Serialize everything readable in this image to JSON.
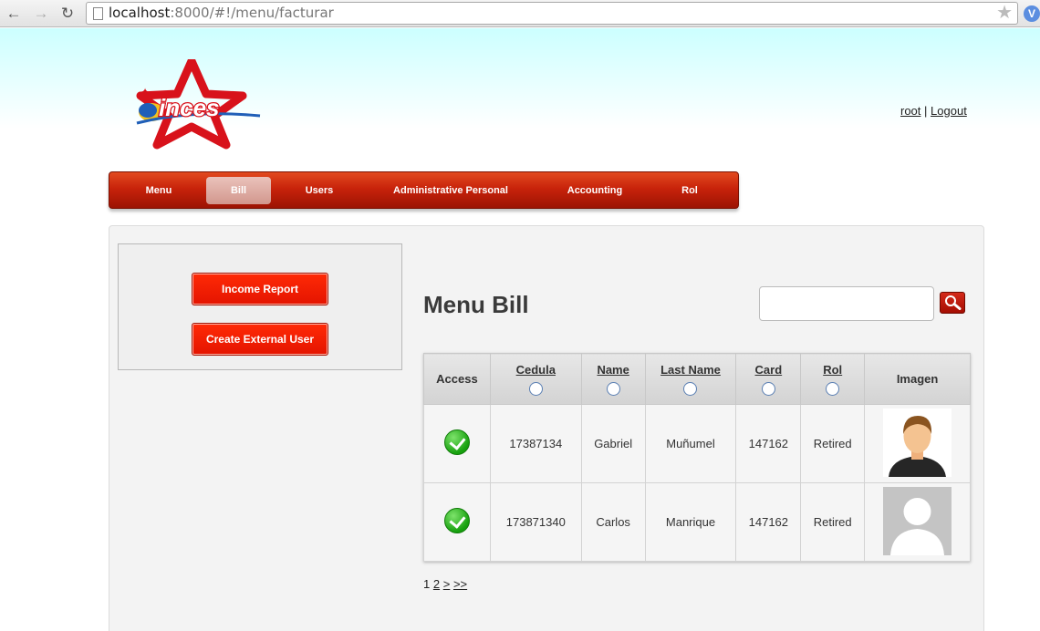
{
  "browser": {
    "url_host": "localhost",
    "url_rest": ":8000/#!/menu/facturar"
  },
  "header": {
    "user": "root",
    "separator": "|",
    "logout": "Logout"
  },
  "nav": {
    "items": [
      {
        "label": "Menu"
      },
      {
        "label": "Bill"
      },
      {
        "label": "Users"
      },
      {
        "label": "Administrative Personal"
      },
      {
        "label": "Accounting"
      },
      {
        "label": "Rol"
      }
    ],
    "active": "Bill"
  },
  "sidebar": {
    "income_report": "Income Report",
    "create_external_user": "Create External User"
  },
  "main": {
    "title": "Menu Bill",
    "search_value": ""
  },
  "table": {
    "headers": {
      "access": "Access",
      "cedula": "Cedula",
      "name": "Name",
      "last_name": "Last Name",
      "card": "Card",
      "rol": "Rol",
      "imagen": "Imagen"
    },
    "rows": [
      {
        "cedula": "17387134",
        "name": "Gabriel",
        "last_name": "Muñumel",
        "card": "147162",
        "rol": "Retired"
      },
      {
        "cedula": "173871340",
        "name": "Carlos",
        "last_name": "Manrique",
        "card": "147162",
        "rol": "Retired"
      }
    ]
  },
  "pager": {
    "current": "1",
    "page2": "2",
    "next": ">",
    "last": ">>"
  },
  "colors": {
    "nav_red": "#c8230b",
    "button_red": "#f21a02",
    "access_green": "#17a00e"
  }
}
